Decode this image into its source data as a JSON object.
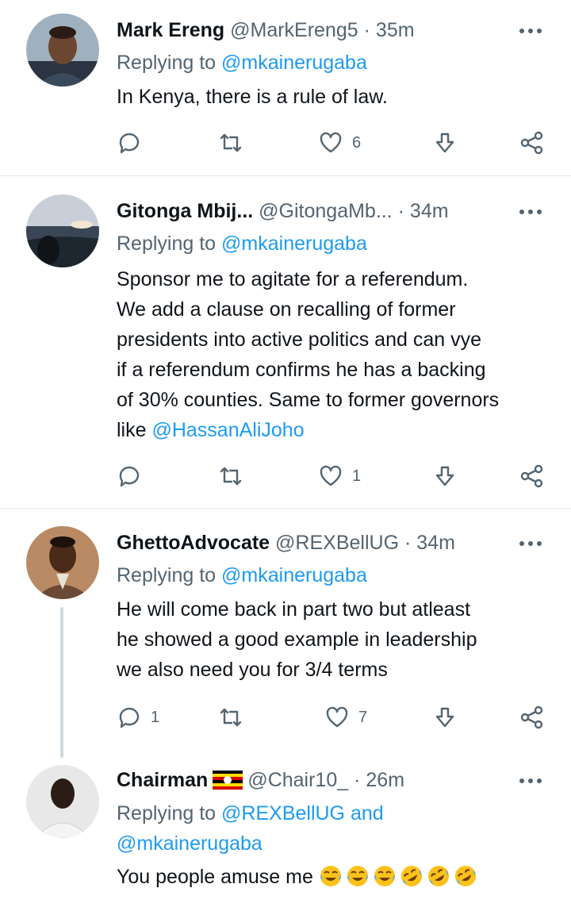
{
  "colors": {
    "link": "#1d9bf0",
    "secondary": "#536471",
    "text": "#0f1419",
    "divider": "#e6e6e6"
  },
  "tweets": [
    {
      "display_name": "Mark Ereng",
      "handle": "@MarkEreng5",
      "separator": "·",
      "time": "35m",
      "replying_prefix": "Replying to",
      "replying_to": "@mkainerugaba",
      "text": "In Kenya, there is a rule of law.",
      "reply_count": "",
      "like_count": "6"
    },
    {
      "display_name": "Gitonga Mbij...",
      "handle": "@GitongaMb...",
      "separator": "·",
      "time": "34m",
      "replying_prefix": "Replying to",
      "replying_to": "@mkainerugaba",
      "text_lines": [
        "Sponsor me to agitate for a referendum.",
        "We add a clause on recalling of former",
        "presidents into active politics and can vye",
        "if a referendum confirms he has a backing",
        "of 30% counties. Same to former governors"
      ],
      "text_last_prefix": "like",
      "text_mention": "@HassanAliJoho",
      "reply_count": "",
      "like_count": "1"
    },
    {
      "display_name": "GhettoAdvocate",
      "handle": "@REXBellUG",
      "separator": "·",
      "time": "34m",
      "replying_prefix": "Replying to",
      "replying_to": "@mkainerugaba",
      "text_lines": [
        "He will come back in part two but atleast",
        "he showed a good example in leadership",
        "we also need you for 3/4 terms"
      ],
      "reply_count": "1",
      "like_count": "7"
    },
    {
      "display_name": "Chairman",
      "flag_icon": "uganda-flag-icon",
      "handle": "@Chair10_",
      "separator": "·",
      "time": "26m",
      "replying_prefix": "Replying to",
      "replying_to": "@REXBellUG and",
      "replying_to_2": "@mkainerugaba",
      "text": "You people amuse me",
      "emojis": [
        "face-with-tears-of-joy-icon",
        "face-with-tears-of-joy-icon",
        "face-with-tears-of-joy-icon",
        "rolling-on-floor-laughing-icon",
        "rolling-on-floor-laughing-icon",
        "rolling-on-floor-laughing-icon"
      ]
    }
  ]
}
